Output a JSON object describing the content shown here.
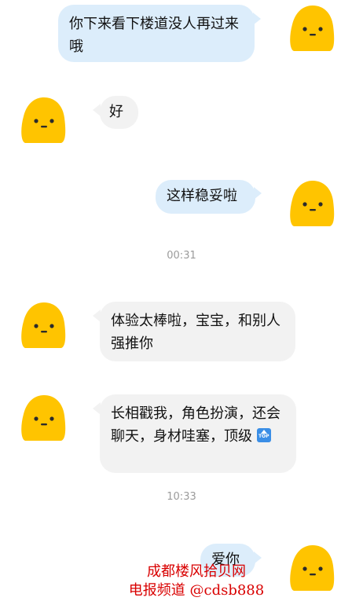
{
  "messages": [
    {
      "id": "m1",
      "side": "out",
      "text": "你下来看下楼道没人再过来哦"
    },
    {
      "id": "m2",
      "side": "in",
      "text": "好"
    },
    {
      "id": "m3",
      "side": "out",
      "text": "这样稳妥啦"
    },
    {
      "id": "m4",
      "side": "in",
      "text": "体验太棒啦，宝宝，和别人强推你"
    },
    {
      "id": "m5",
      "side": "in",
      "text": "长相戳我，角色扮演，还会聊天，身材哇塞，顶级",
      "emoji": "top-icon",
      "emoji_text": "TOP"
    },
    {
      "id": "m6",
      "side": "out",
      "text": "爱你"
    }
  ],
  "timestamps": [
    "00:31",
    "10:33"
  ],
  "watermark": {
    "line1": "成都楼风拾贝网",
    "line2": "电报频道 @cdsb888",
    "color": "#d90000"
  },
  "colors": {
    "out_bubble": "#dcedfb",
    "in_bubble": "#f2f2f2",
    "avatar": "#ffc400"
  },
  "avatar_icon": "yellow-blob-face-icon"
}
